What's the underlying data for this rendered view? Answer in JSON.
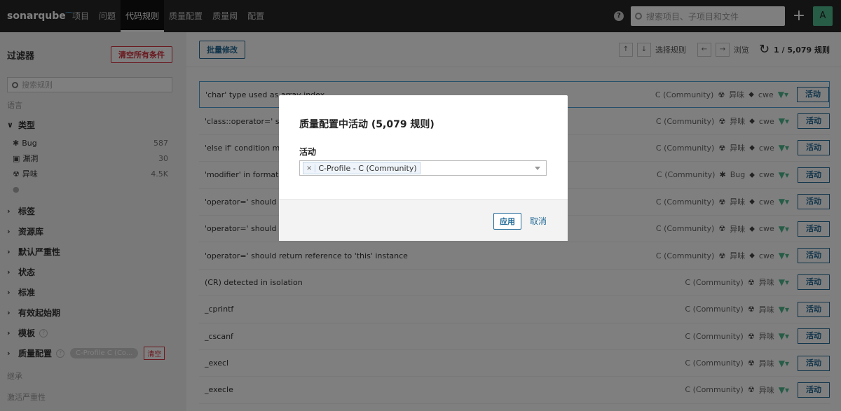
{
  "topbar": {
    "logo": "sonarqube",
    "nav": [
      "项目",
      "问题",
      "代码规则",
      "质量配置",
      "质量阈",
      "配置"
    ],
    "active_nav": "代码规则",
    "search_placeholder": "搜索项目、子项目和文件",
    "avatar_letter": "A"
  },
  "sidebar": {
    "title": "过滤器",
    "clear_all_label": "清空所有条件",
    "search_placeholder": "搜索规则",
    "language_label": "语言",
    "type_label": "类型",
    "types": [
      {
        "icon": "bug-icon",
        "label": "Bug",
        "count": "587"
      },
      {
        "icon": "lock-icon",
        "label": "漏洞",
        "count": "30"
      },
      {
        "icon": "code-smell-icon",
        "label": "异味",
        "count": "4.5K"
      }
    ],
    "facets": [
      "标签",
      "资源库",
      "默认严重性",
      "状态",
      "标准",
      "有效起始期",
      "模板",
      "质量配置"
    ],
    "profile_chip": "C-Profile C (Co...",
    "profile_clear": "清空",
    "inherit_label": "继承",
    "active_severity_label": "激活严重性"
  },
  "toolbar": {
    "bulk_change_label": "批量修改",
    "select_rule_label": "选择规则",
    "browse_label": "浏览",
    "pager": "1 / 5,079 规则"
  },
  "rules": [
    {
      "name": "'char' type used as array index",
      "lang": "C (Community)",
      "type": "异味",
      "tag": "cwe"
    },
    {
      "name": "'class::operator=' should check for assignment to self",
      "lang": "C (Community)",
      "type": "异味",
      "tag": "cwe"
    },
    {
      "name": "'else if' condition matches previous condition",
      "lang": "C (Community)",
      "type": "异味",
      "tag": "cwe"
    },
    {
      "name": "'modifier' in format string",
      "lang": "C (Community)",
      "type": "Bug",
      "tag": "cwe"
    },
    {
      "name": "'operator=' should check for assignment to self",
      "lang": "C (Community)",
      "type": "异味",
      "tag": "cwe"
    },
    {
      "name": "'operator=' should ensure all members are assigned",
      "lang": "C (Community)",
      "type": "异味",
      "tag": "cwe"
    },
    {
      "name": "'operator=' should return reference to 'this' instance",
      "lang": "C (Community)",
      "type": "异味",
      "tag": "cwe"
    },
    {
      "name": "(CR) detected in isolation",
      "lang": "C (Community)",
      "type": "异味",
      "tag": ""
    },
    {
      "name": "_cprintf",
      "lang": "C (Community)",
      "type": "异味",
      "tag": ""
    },
    {
      "name": "_cscanf",
      "lang": "C (Community)",
      "type": "异味",
      "tag": ""
    },
    {
      "name": "_execl",
      "lang": "C (Community)",
      "type": "异味",
      "tag": ""
    },
    {
      "name": "_execle",
      "lang": "C (Community)",
      "type": "异味",
      "tag": ""
    }
  ],
  "activate_label": "活动",
  "modal": {
    "title": "质量配置中活动 (5,079 规则)",
    "field_label": "活动",
    "selected_tag": "C-Profile - C (Community)",
    "apply_label": "应用",
    "cancel_label": "取消"
  }
}
